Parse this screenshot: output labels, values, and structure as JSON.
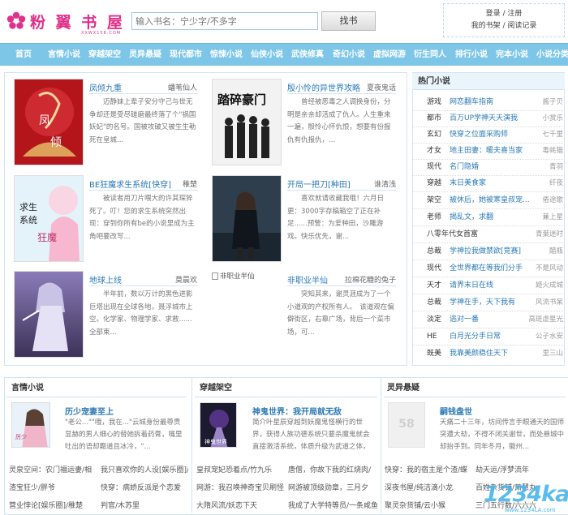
{
  "site": {
    "logo_text": "粉 翼 书 屋",
    "logo_sub": "XXWX158.COM",
    "search_placeholder": "输入书名：宁少字/不多字",
    "search_button": "找书",
    "login": "登录 / 注册",
    "my_shelf": "我的书架 / 阅读记录"
  },
  "nav": [
    "首页",
    "言情小说",
    "穿越架空",
    "灵异悬疑",
    "现代都市",
    "惊悚小说",
    "仙侠小说",
    "武侠修真",
    "奇幻小说",
    "虚拟网游",
    "衍生同人",
    "排行小说",
    "完本小说",
    "小说分类"
  ],
  "featured": [
    {
      "title": "凤倾九重",
      "author": "蟠苇仙人",
      "desc": "迈静妹上辈子安分守己与世无争却还是受尽磋磨最终落了个\"祸国妖妃\"的名号。国被攻破又被生生勒死在皇城..."
    },
    {
      "title": "殷小怜的异世界攻略",
      "author": "夏夜鬼话",
      "desc": "曾经被恶毒之人调换身份，分明是亲亲却活成了仇人。人生重来一遍，殷怜心怀仇恨，想要有份报仇有仇报仇，..."
    },
    {
      "title": "BE狂魔求生系统[快穿]",
      "author": "稚楚",
      "desc": "被读者用刀片喂大的许其琛猝死了。叮！您的求生系统突然出现：穿到你所有be的小说里成为主角吧要改写..."
    },
    {
      "title": "开局一把刀[种田]",
      "author": "谁清浅",
      "desc": "喜欢就请收藏我哦！六月日更：3000字存稿箱空了正在补足......预警：为爱种田，沙雕游戏。快乐优先，谢..."
    },
    {
      "title": "地球上线",
      "author": "莫晨欢",
      "desc": "半年前，数以万计的黑色进影巨塔出现在全球各地，聂浮城市上空。化学家、物理学家、求救......全部束..."
    },
    {
      "title": "非职业半仙",
      "author": "拉棉花糖的兔子",
      "img_alt": "非职业半仙",
      "desc": "突知其来，谢灵涯成为了一个小道观的产权所有人。　该道观在偏僻街区，右靠广场，背后一个菜市场，可..."
    }
  ],
  "hot_header": "热门小说",
  "hot": [
    {
      "cat": "游戏",
      "name": "网恋翻车指南",
      "author": "酱子贝"
    },
    {
      "cat": "都市",
      "name": "百万UP学神天天演我",
      "author": "小赏乐"
    },
    {
      "cat": "玄幻",
      "name": "快穿之位面采购师",
      "author": "七千里"
    },
    {
      "cat": "才女",
      "name": "地主田妻：暖夫喜当家",
      "author": "毒蚝猫"
    },
    {
      "cat": "现代",
      "name": "名门隐婚",
      "author": "青羽"
    },
    {
      "cat": "穿越",
      "name": "末日美食家",
      "author": "纤夜"
    },
    {
      "cat": "架空",
      "name": "被休后，她被寒皇叔宠...",
      "author": "倦途歌"
    },
    {
      "cat": "老师",
      "name": "揭乱文，求翻",
      "author": "蒹上星"
    },
    {
      "cat": "八零年代女首富",
      "name": "",
      "author": "青葉迷时"
    },
    {
      "cat": "总裁",
      "name": "学神拉我做禁欲[竞赛]",
      "author": "醋瓶"
    },
    {
      "cat": "现代",
      "name": "全世界都在等我们分手",
      "author": "不是风动"
    },
    {
      "cat": "天才",
      "name": "请界末日在线",
      "author": "姬火成城"
    },
    {
      "cat": "总裁",
      "name": "学神在手，天下我有",
      "author": "风流书呆"
    },
    {
      "cat": "淡定",
      "name": "逃对一番",
      "author": "高斑虚星光"
    },
    {
      "cat": "HE",
      "name": "白月光分手日常",
      "author": "公子水安"
    },
    {
      "cat": "既美",
      "name": "我靠美颜稳住天下",
      "author": "里三山"
    }
  ],
  "sections": [
    {
      "title": "言情小说",
      "book_title": "历少宠妻至上",
      "desc": "\"老公...\"\"哦，我在...\"云城身份最尊贵显赫的男人细心的替她拆着药膏，嘴里吐出的语却霸道且冰冷，\"...",
      "links": [
        "灵泉空间：农门福运妻/相",
        "我只喜欢你的人设[娱乐圈]/穿",
        "渣宝狂少/胖爷",
        "快穿：病娇反派是个恋爱",
        "营业悖论[娱乐圈]/稚楚",
        "判官/木苏里"
      ]
    },
    {
      "title": "穿越架空",
      "book_title": "神鬼世界：我开局就无敌",
      "desc": "简介叶星辰穿越到妖魔鬼怪横行的世界，获得人族功德系统只要杀魔鬼就会直接激活系统，体质升级为武道之体，恭喜...",
      "links": [
        "皇叔宠妃恐着点/竹九乐",
        "唐僧，你故下我的红烧肉/",
        "网游：我召唤神奇宝贝刷怪",
        "网游被顶级勋章，三月夕",
        "大隋风流/妖恋下天",
        "我成了大学特等员/一条咸鱼"
      ]
    },
    {
      "title": "灵异悬疑",
      "book_title": "嗣钱盘世",
      "cover_text": "58",
      "desc": "天痛二十三年，坊间传言手眼通天的国师突遭大劫，不得不闭关谢世，而处悬城中却抬手到。同年冬月，徽州...",
      "links": [
        "快穿：我的宿主是个渣/蝶",
        "劫天运/浮梦流年",
        "深夜书屋/纯洁滴小龙",
        "百姓杂货铺/萧慧丸",
        "聚灵杂货铺/云小猴",
        "三门五行数/六六六"
      ]
    }
  ],
  "watermark": "1234ka",
  "watermark_sub": "www.1234LA.com",
  "colors": {
    "nav_bg": "#7ec6e8",
    "accent": "#e0308a",
    "link": "#2b79b5",
    "border": "#cfe5f3"
  }
}
